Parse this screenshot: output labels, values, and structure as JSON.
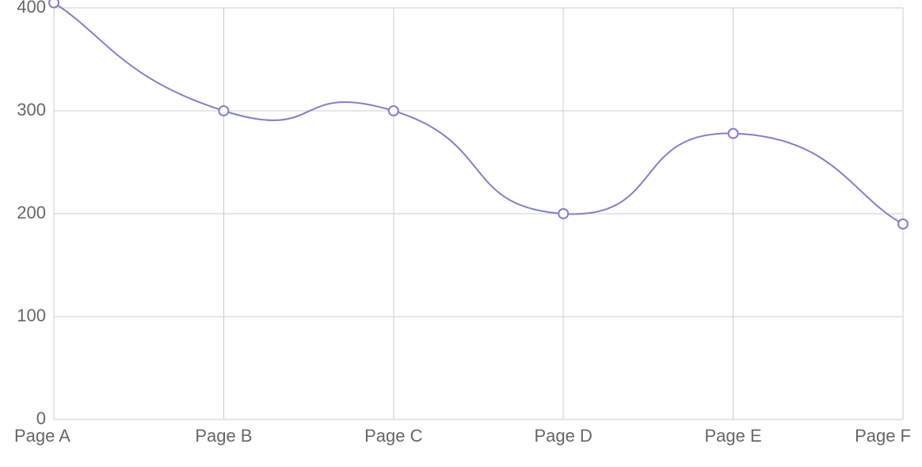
{
  "chart_data": {
    "type": "line",
    "categories": [
      "Page A",
      "Page B",
      "Page C",
      "Page D",
      "Page E",
      "Page F"
    ],
    "values": [
      405,
      300,
      300,
      200,
      278,
      190
    ],
    "xlabel": "",
    "ylabel": "",
    "ylim": [
      0,
      400
    ],
    "y_ticks": [
      0,
      100,
      200,
      300,
      400
    ],
    "line_color": "#8080c8",
    "grid": true
  }
}
